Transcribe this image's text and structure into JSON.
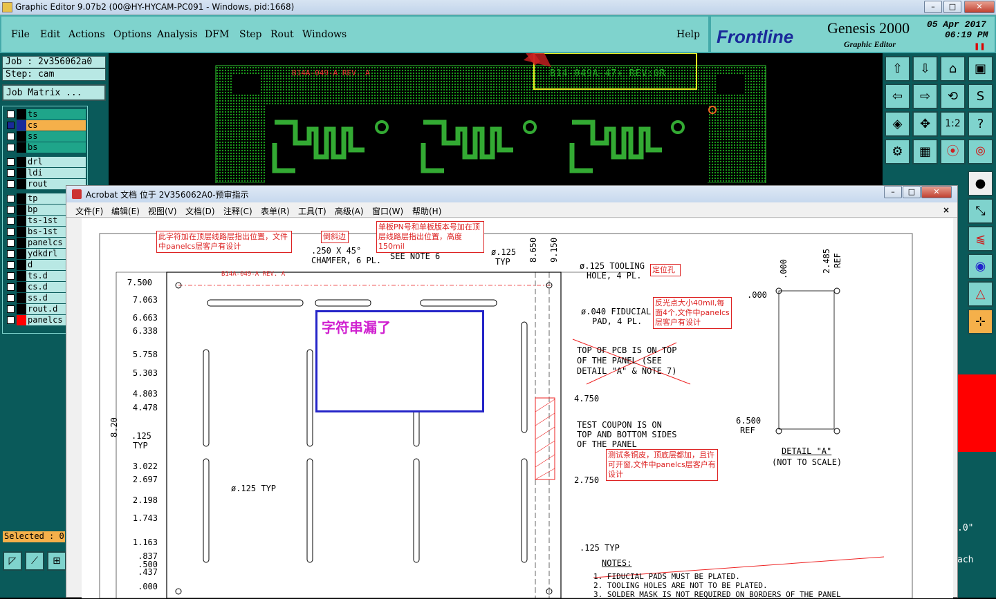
{
  "window": {
    "title": "Graphic Editor 9.07b2 (00@HY-HYCAM-PC091 - Windows, pid:1668)"
  },
  "menu": {
    "items": [
      "File",
      "Edit",
      "Actions",
      "Options",
      "Analysis",
      "DFM",
      "Step",
      "Rout",
      "Windows"
    ],
    "help": "Help"
  },
  "brand": {
    "logo": "Frontline",
    "product": "Genesis 2000",
    "subtitle": "Graphic Editor",
    "date": "05 Apr 2017",
    "time": "06:19 PM"
  },
  "job": {
    "job_label": "Job : 2v356062a0",
    "step_label": "Step: cam",
    "matrix_button": "Job Matrix ..."
  },
  "layers": [
    {
      "name": "ts",
      "color": "#1fa58a"
    },
    {
      "name": "cs",
      "color": "#f5b04a"
    },
    {
      "name": "ss",
      "color": "#1fa58a"
    },
    {
      "name": "bs",
      "color": "#1fa58a"
    },
    {
      "name": "drl",
      "color": "#b8e8e4"
    },
    {
      "name": "ldi",
      "color": "#b8e8e4"
    },
    {
      "name": "rout",
      "color": "#b8e8e4"
    },
    {
      "name": "tp",
      "color": "#b8e8e4"
    },
    {
      "name": "bp",
      "color": "#b8e8e4"
    },
    {
      "name": "ts-1st",
      "color": "#b8e8e4"
    },
    {
      "name": "bs-1st",
      "color": "#b8e8e4"
    },
    {
      "name": "panelcs",
      "color": "#b8e8e4"
    },
    {
      "name": "ydkdrl",
      "color": "#b8e8e4"
    },
    {
      "name": "d",
      "color": "#b8e8e4"
    },
    {
      "name": "ts.d",
      "color": "#b8e8e4"
    },
    {
      "name": "cs.d",
      "color": "#b8e8e4"
    },
    {
      "name": "ss.d",
      "color": "#b8e8e4"
    },
    {
      "name": "rout.d",
      "color": "#b8e8e4"
    },
    {
      "name": "panelcs",
      "color": "#b8e8e4"
    }
  ],
  "selected": "Selected : 0",
  "canvas": {
    "label_left": "B14A-049-A REV. A",
    "label_right": "B14-049A-47+ REV:0R"
  },
  "acrobat": {
    "title": "Acrobat 文档 位于 2V356062A0-预审指示",
    "menu": [
      "文件(F)",
      "编辑(E)",
      "视图(V)",
      "文档(D)",
      "注释(C)",
      "表单(R)",
      "工具(T)",
      "高级(A)",
      "窗口(W)",
      "帮助(H)"
    ]
  },
  "drawing": {
    "dims_left": [
      "7.500",
      "7.063",
      "6.663",
      "6.338",
      "5.758",
      "5.303",
      "4.803",
      "4.478",
      "3.022",
      "2.697",
      "2.198",
      "1.743",
      "1.163",
      ".837",
      ".500",
      ".437",
      ".000"
    ],
    "vertical_label": "8.20",
    "dim_125": ".125",
    "typ": "TYP",
    "chamfer": ".250 X 45°",
    "chamfer2": "CHAMFER, 6 PL.",
    "see_note": "SEE NOTE 6",
    "dia125": "ø.125",
    "dia125typ": "TYP",
    "top_dims": [
      "8.650",
      "9.150"
    ],
    "tooling": "ø.125 TOOLING",
    "tooling2": "HOLE, 4 PL.",
    "fiducial": "ø.040 FIDUCIAL",
    "fiducial2": "PAD, 4 PL.",
    "top_pcb": [
      "TOP OF PCB IS ON TOP",
      "OF THE PANEL (SEE",
      "DETAIL \"A\" & NOTE 7)"
    ],
    "d4750": "4.750",
    "d2750": "2.750",
    "coupon": [
      "TEST COUPON IS ON",
      "TOP AND BOTTOM SIDES",
      "OF THE PANEL"
    ],
    "dia125b": "ø.125 TYP",
    "typ125": ".125 TYP",
    "notes_title": "NOTES:",
    "notes": [
      "1. FIDUCIAL PADS MUST BE PLATED.",
      "2. TOOLING HOLES ARE NOT TO BE PLATED.",
      "3. SOLDER MASK IS NOT REQUIRED ON BORDERS OF THE PANEL"
    ],
    "detail_a": "DETAIL \"A\"",
    "not_scale": "(NOT TO SCALE)",
    "d000": ".000",
    "d000b": ".000",
    "d2485": "2.485",
    "ref": "REF",
    "d6500": "6.500",
    "ref2": "REF",
    "panel_label": "B14A-049-A REV. A",
    "missing": "字符串漏了",
    "ann1": "此字符加在顶层线路层指出位置，文件中panelcs层客户有设计",
    "ann2": "倒斜边",
    "ann3": "单板PN号和单板版本号加在顶层线路层指出位置，高度150mil",
    "ann4": "定位孔",
    "ann5": "反光点大小40mil,每面4个,文件中panelcs层客户有设计",
    "ann6": "测试条铜皮，顶底层都加，且许可开窗,文件中panelcs层客户有设计"
  },
  "right_partial": {
    "a": ".0\"",
    "b": "ach"
  }
}
